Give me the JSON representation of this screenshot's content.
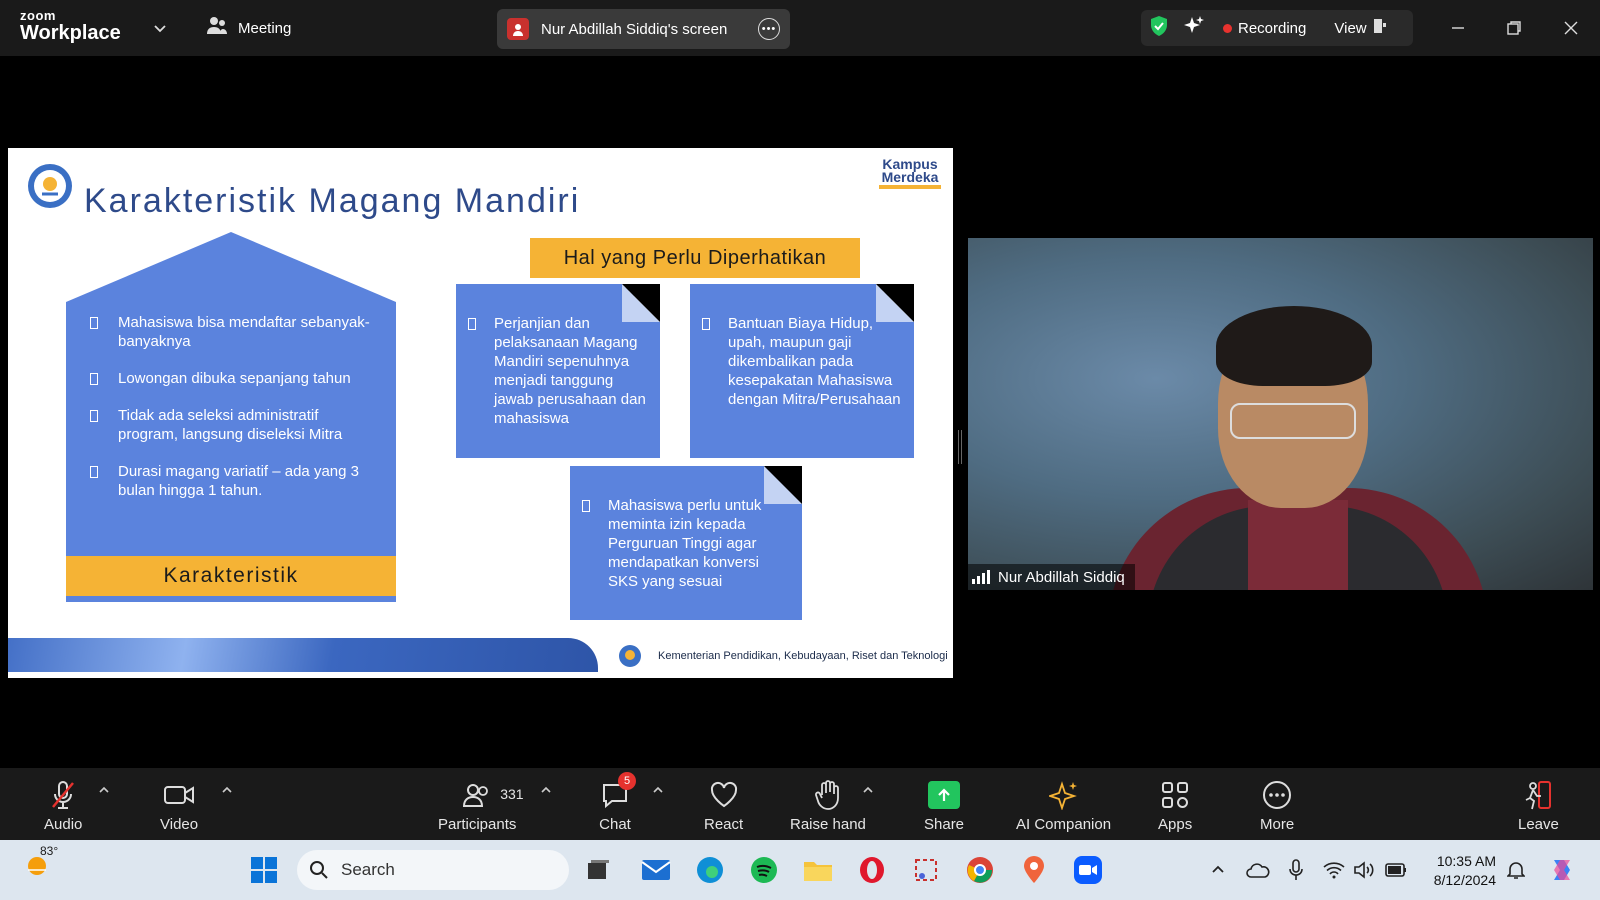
{
  "titlebar": {
    "logo_line1": "zoom",
    "logo_line2": "Workplace",
    "meeting_label": "Meeting",
    "screen_share_label": "Nur Abdillah Siddiq's screen",
    "recording_label": "Recording",
    "view_label": "View"
  },
  "slide": {
    "title": "Karakteristik Magang Mandiri",
    "brand_line1": "Kampus",
    "brand_line2": "Merdeka",
    "house_items": [
      "Mahasiswa bisa mendaftar sebanyak-banyaknya",
      "Lowongan dibuka sepanjang tahun",
      "Tidak ada seleksi administratif program, langsung diseleksi Mitra",
      "Durasi magang variatif – ada yang 3 bulan hingga 1 tahun."
    ],
    "house_label": "Karakteristik",
    "notes_header": "Hal yang Perlu Diperhatikan",
    "note1": "Perjanjian dan pelaksanaan Magang Mandiri sepenuhnya menjadi tanggung jawab perusahaan dan mahasiswa",
    "note2": "Bantuan Biaya Hidup, upah, maupun gaji dikembalikan pada kesepakatan Mahasiswa dengan Mitra/Perusahaan",
    "note3": "Mahasiswa perlu untuk meminta izin kepada Perguruan Tinggi agar mendapatkan konversi SKS yang sesuai",
    "footer": "Kementerian Pendidikan, Kebudayaan, Riset dan Teknologi"
  },
  "video": {
    "participant_name": "Nur Abdillah Siddiq"
  },
  "controls": {
    "audio": "Audio",
    "video": "Video",
    "participants": "Participants",
    "participants_count": "331",
    "chat": "Chat",
    "chat_badge": "5",
    "react": "React",
    "raise_hand": "Raise hand",
    "share": "Share",
    "ai_companion": "AI Companion",
    "apps": "Apps",
    "more": "More",
    "leave": "Leave"
  },
  "taskbar": {
    "weather": "83°",
    "search_placeholder": "Search",
    "time": "10:35 AM",
    "date": "8/12/2024"
  },
  "colors": {
    "accent_yellow": "#f5b335",
    "slide_blue": "#5b83dd",
    "recording_red": "#e8322e",
    "share_green": "#22c55e"
  }
}
